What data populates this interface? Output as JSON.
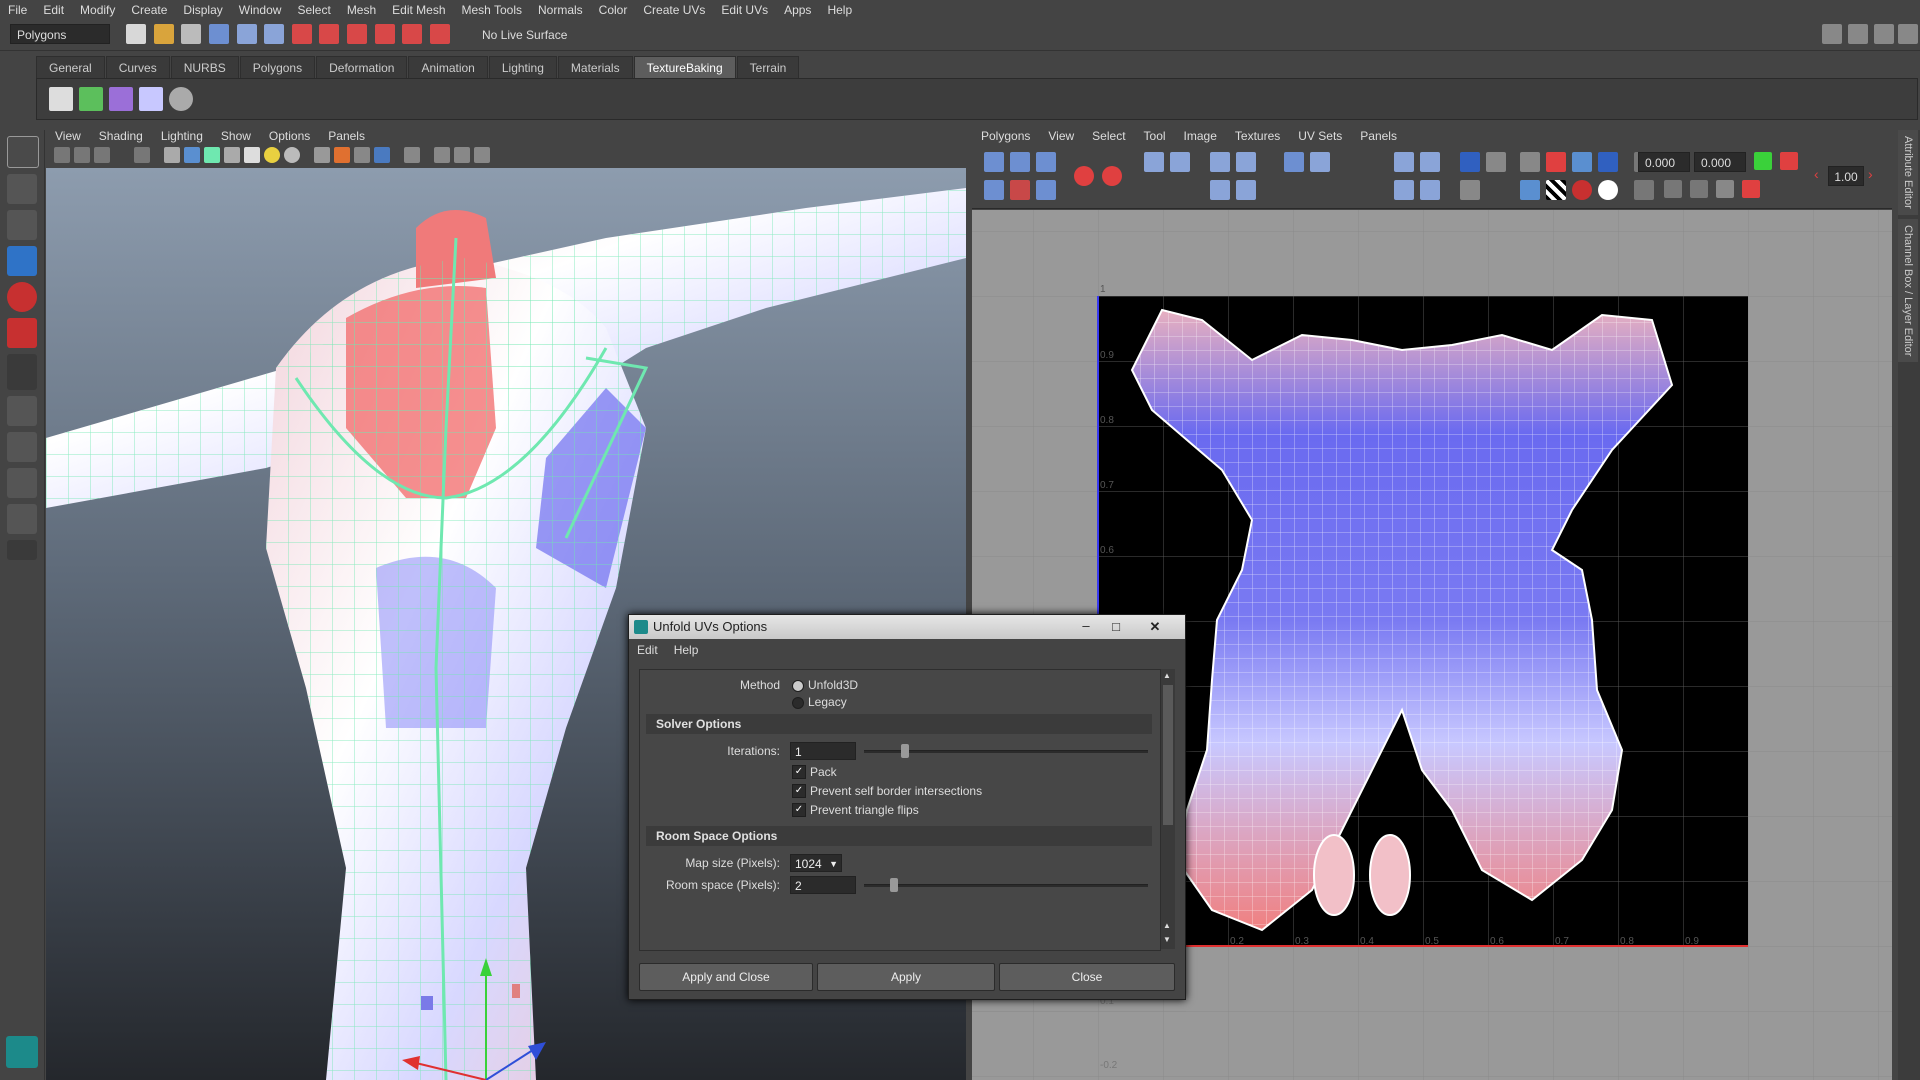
{
  "menubar": {
    "items": [
      "File",
      "Edit",
      "Modify",
      "Create",
      "Display",
      "Window",
      "Select",
      "Mesh",
      "Edit Mesh",
      "Mesh Tools",
      "Normals",
      "Color",
      "Create UVs",
      "Edit UVs",
      "Apps",
      "Help"
    ]
  },
  "statusline": {
    "mode": "Polygons",
    "live_surface": "No Live Surface"
  },
  "shelf": {
    "tabs": [
      "General",
      "Curves",
      "NURBS",
      "Polygons",
      "Deformation",
      "Animation",
      "Lighting",
      "Materials",
      "TextureBaking",
      "Terrain"
    ],
    "active_tab": "TextureBaking"
  },
  "viewport": {
    "menu": [
      "View",
      "Shading",
      "Lighting",
      "Show",
      "Options",
      "Panels"
    ]
  },
  "uv_editor": {
    "menu": [
      "Polygons",
      "View",
      "Select",
      "Tool",
      "Image",
      "Textures",
      "UV Sets",
      "Panels"
    ],
    "u_value": "0.000",
    "v_value": "0.000",
    "zoom": "1.00",
    "x_ticks": [
      "0.2",
      "0.3",
      "0.4",
      "0.5",
      "0.6",
      "0.7",
      "0.8",
      "0.9"
    ],
    "y_ticks": [
      "0.9",
      "0.8",
      "0.7",
      "0.6"
    ],
    "top_label": "1",
    "below_labels": [
      "0.1",
      "-0.2"
    ]
  },
  "side_tabs": [
    "Attribute Editor",
    "Channel Box / Layer Editor"
  ],
  "dialog": {
    "title": "Unfold UVs Options",
    "menu": [
      "Edit",
      "Help"
    ],
    "method_label": "Method",
    "method_options": [
      "Unfold3D",
      "Legacy"
    ],
    "solver_section": "Solver Options",
    "iterations_label": "Iterations:",
    "iterations_value": "1",
    "iterations_fraction": 0.13,
    "checks": [
      "Pack",
      "Prevent self border intersections",
      "Prevent triangle flips"
    ],
    "room_section": "Room Space Options",
    "map_size_label": "Map size (Pixels):",
    "map_size_value": "1024",
    "room_space_label": "Room space (Pixels):",
    "room_space_value": "2",
    "room_space_fraction": 0.09,
    "buttons": {
      "apply_close": "Apply and Close",
      "apply": "Apply",
      "close": "Close"
    }
  },
  "colors": {
    "accent": "#5d5d5d",
    "mesh_wire": "#6fe8b0",
    "uv_bg": "#000000"
  }
}
